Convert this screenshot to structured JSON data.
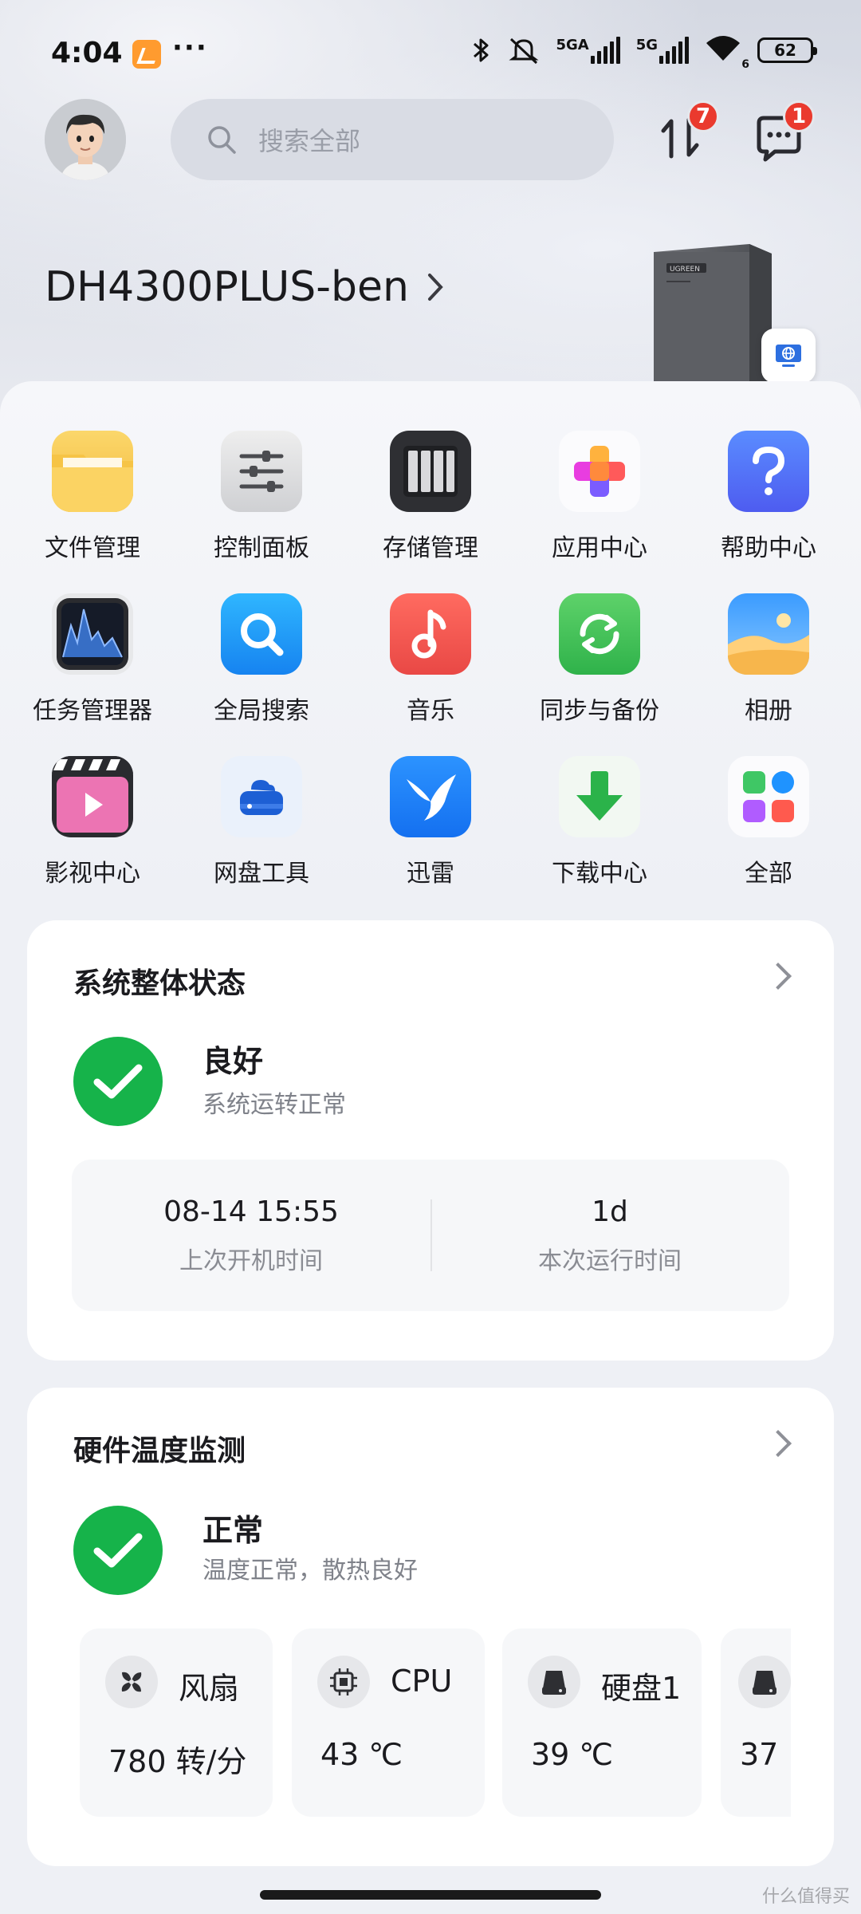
{
  "status_bar": {
    "time": "4:04",
    "dots": "···",
    "net1": "5GA",
    "net2": "5G",
    "wifi_sub": "6",
    "battery": "62"
  },
  "header": {
    "search_placeholder": "搜索全部",
    "transfer_badge": "7",
    "message_badge": "1"
  },
  "device": {
    "name": "DH4300PLUS-ben",
    "brand": "UGREEN"
  },
  "apps": [
    {
      "label": "文件管理",
      "icon": "folder-icon"
    },
    {
      "label": "控制面板",
      "icon": "sliders-icon"
    },
    {
      "label": "存储管理",
      "icon": "storage-icon"
    },
    {
      "label": "应用中心",
      "icon": "app-center-icon"
    },
    {
      "label": "帮助中心",
      "icon": "help-icon"
    },
    {
      "label": "任务管理器",
      "icon": "task-manager-icon"
    },
    {
      "label": "全局搜索",
      "icon": "global-search-icon"
    },
    {
      "label": "音乐",
      "icon": "music-icon"
    },
    {
      "label": "同步与备份",
      "icon": "sync-icon"
    },
    {
      "label": "相册",
      "icon": "photos-icon"
    },
    {
      "label": "影视中心",
      "icon": "video-icon"
    },
    {
      "label": "网盘工具",
      "icon": "cloud-disk-icon"
    },
    {
      "label": "迅雷",
      "icon": "xunlei-icon"
    },
    {
      "label": "下载中心",
      "icon": "download-icon"
    },
    {
      "label": "全部",
      "icon": "all-apps-icon"
    }
  ],
  "system_status": {
    "title": "系统整体状态",
    "state": "良好",
    "desc": "系统运转正常",
    "boot_time": "08-14 15:55",
    "boot_time_label": "上次开机时间",
    "uptime": "1d",
    "uptime_label": "本次运行时间"
  },
  "hardware_temp": {
    "title": "硬件温度监测",
    "state": "正常",
    "desc": "温度正常，散热良好",
    "sensors": [
      {
        "name": "风扇",
        "value": "780 转/分",
        "icon": "fan-icon"
      },
      {
        "name": "CPU",
        "value": "43 ℃",
        "icon": "cpu-icon"
      },
      {
        "name": "硬盘1",
        "value": "39 ℃",
        "icon": "disk-icon"
      },
      {
        "name": "",
        "value": "37",
        "icon": "disk-icon"
      }
    ]
  },
  "watermark": "什么值得买",
  "colors": {
    "ok_green": "#16b34a",
    "badge_red": "#ea3a2e"
  }
}
